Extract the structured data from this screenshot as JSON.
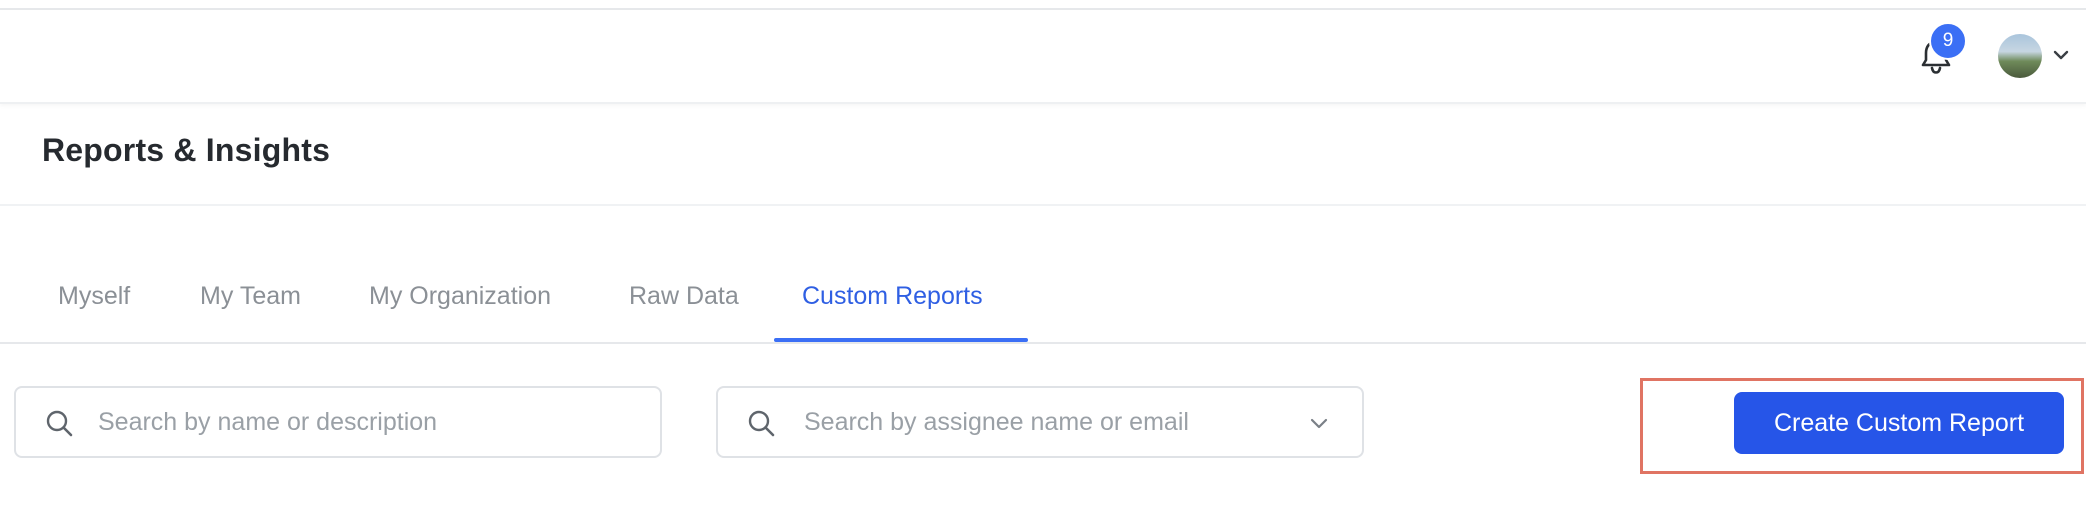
{
  "topbar": {
    "notification_count": "9",
    "icons": {
      "bell": "bell-icon",
      "avatar": "user-avatar",
      "chevron": "chevron-down-icon"
    }
  },
  "page": {
    "title": "Reports & Insights"
  },
  "tabs": [
    {
      "label": "Myself",
      "active": false
    },
    {
      "label": "My Team",
      "active": false
    },
    {
      "label": "My Organization",
      "active": false
    },
    {
      "label": "Raw Data",
      "active": false
    },
    {
      "label": "Custom Reports",
      "active": true
    }
  ],
  "filters": {
    "name_search": {
      "placeholder": "Search by name or description",
      "value": ""
    },
    "assignee_search": {
      "placeholder": "Search by assignee name or email",
      "value": ""
    }
  },
  "actions": {
    "create_label": "Create Custom Report"
  },
  "colors": {
    "accent": "#2655e8",
    "badge": "#3b6ff5",
    "active_tab": "#2f5fe3",
    "highlight": "#e07463"
  }
}
